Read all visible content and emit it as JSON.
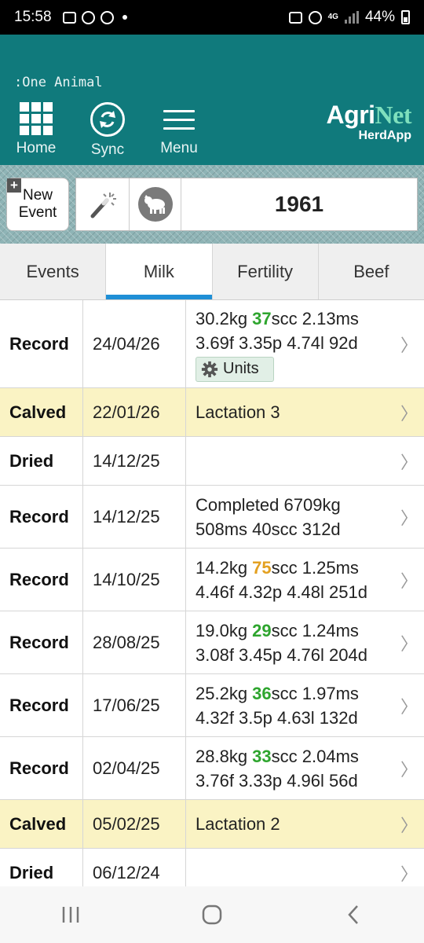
{
  "status_bar": {
    "time": "15:58",
    "network": "4G",
    "battery": "44%"
  },
  "header": {
    "breadcrumb": ":One Animal",
    "nav": [
      {
        "label": "Home",
        "icon": "grid-icon"
      },
      {
        "label": "Sync",
        "icon": "sync-icon"
      },
      {
        "label": "Menu",
        "icon": "hamburger-icon"
      }
    ],
    "brand": {
      "part1": "Agri",
      "part2": "Net",
      "sub": "HerdApp"
    },
    "colors": {
      "header_bg": "#107a7c",
      "brand_accent": "#7fe0bd"
    }
  },
  "action_bar": {
    "new_event_line1": "New",
    "new_event_line2": "Event",
    "animal_id": "1961"
  },
  "tabs": [
    {
      "label": "Events",
      "active": false
    },
    {
      "label": "Milk",
      "active": true
    },
    {
      "label": "Fertility",
      "active": false
    },
    {
      "label": "Beef",
      "active": false
    }
  ],
  "records": [
    {
      "type": "Record",
      "date": "24/04/26",
      "style": "record",
      "line1_pre": "30.2kg ",
      "scc": "37",
      "scc_color": "green",
      "line1_post": "scc 2.13ms",
      "line2": "3.69f 3.35p 4.74l 92d",
      "units_label": "Units"
    },
    {
      "type": "Calved",
      "date": "22/01/26",
      "style": "calved",
      "detail": "Lactation 3"
    },
    {
      "type": "Dried",
      "date": "14/12/25",
      "style": "plain",
      "detail": ""
    },
    {
      "type": "Record",
      "date": "14/12/25",
      "style": "record",
      "detail_line1": "Completed 6709kg",
      "detail_line2": "508ms 40scc 312d"
    },
    {
      "type": "Record",
      "date": "14/10/25",
      "style": "record",
      "line1_pre": "14.2kg ",
      "scc": "75",
      "scc_color": "orange",
      "line1_post": "scc 1.25ms",
      "line2": "4.46f 4.32p 4.48l 251d"
    },
    {
      "type": "Record",
      "date": "28/08/25",
      "style": "record",
      "line1_pre": "19.0kg ",
      "scc": "29",
      "scc_color": "green",
      "line1_post": "scc 1.24ms",
      "line2": "3.08f 3.45p 4.76l 204d"
    },
    {
      "type": "Record",
      "date": "17/06/25",
      "style": "record",
      "line1_pre": "25.2kg ",
      "scc": "36",
      "scc_color": "green",
      "line1_post": "scc 1.97ms",
      "line2": "4.32f 3.5p 4.63l 132d"
    },
    {
      "type": "Record",
      "date": "02/04/25",
      "style": "record",
      "line1_pre": "28.8kg ",
      "scc": "33",
      "scc_color": "green",
      "line1_post": "scc 2.04ms",
      "line2": "3.76f 3.33p 4.96l 56d"
    },
    {
      "type": "Calved",
      "date": "05/02/25",
      "style": "calved",
      "detail": "Lactation 2"
    },
    {
      "type": "Dried",
      "date": "06/12/24",
      "style": "plain",
      "detail": ""
    }
  ],
  "nav_bar": {
    "items": [
      "recents-icon",
      "home-circle-icon",
      "back-icon"
    ]
  }
}
